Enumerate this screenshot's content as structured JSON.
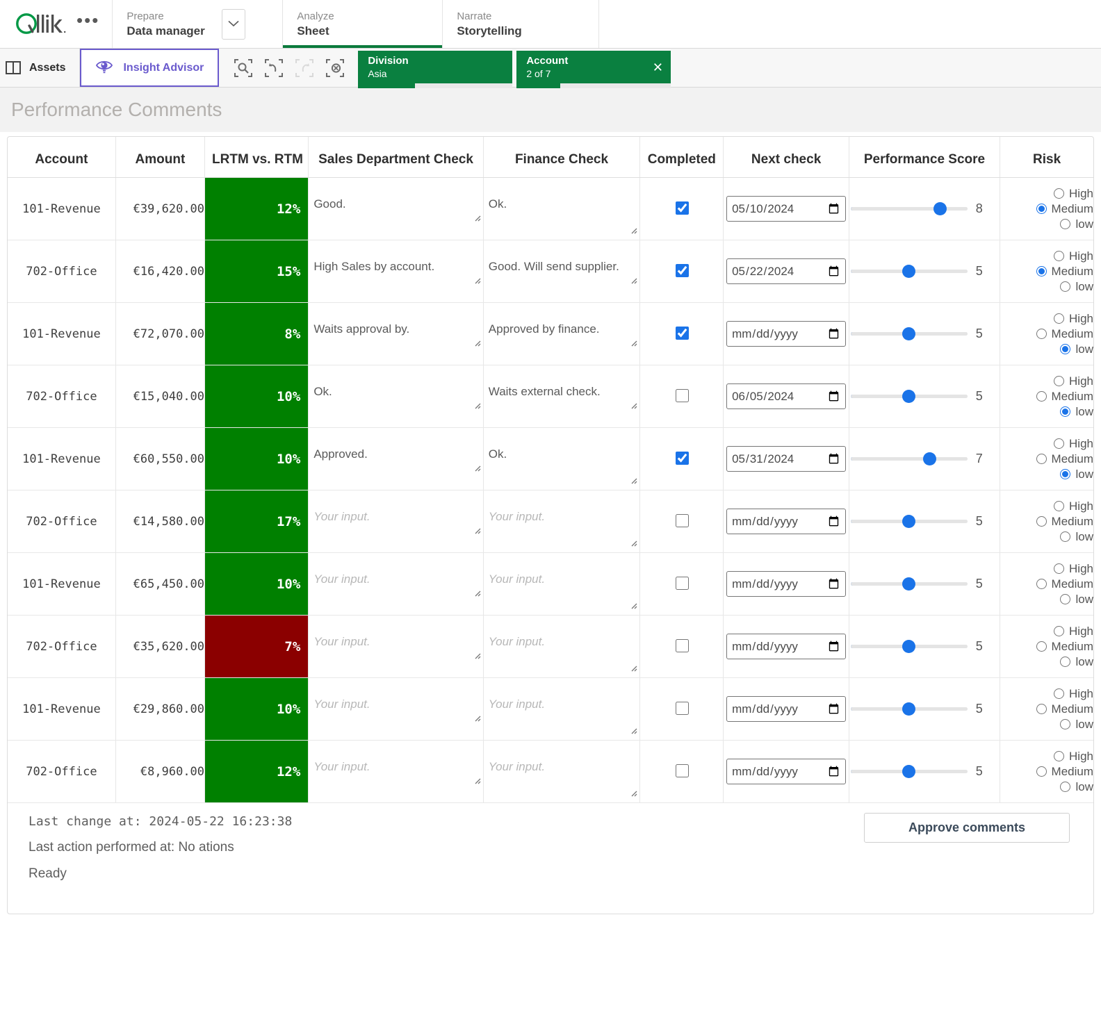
{
  "topnav": {
    "logo_text": "Qlik",
    "overflow_menu": "•••",
    "sections": [
      {
        "kicker": "Prepare",
        "title": "Data manager"
      },
      {
        "kicker": "Analyze",
        "title": "Sheet"
      },
      {
        "kicker": "Narrate",
        "title": "Storytelling"
      }
    ]
  },
  "subbar": {
    "assets_label": "Assets",
    "insight_advisor_label": "Insight Advisor",
    "tools": [
      {
        "name": "selection-search-icon",
        "disabled": false
      },
      {
        "name": "step-back-icon",
        "disabled": false
      },
      {
        "name": "step-forward-icon",
        "disabled": true
      },
      {
        "name": "clear-selections-icon",
        "disabled": false
      }
    ],
    "chips": [
      {
        "field": "Division",
        "value": "Asia",
        "fill_pct": 37,
        "closable": false
      },
      {
        "field": "Account",
        "value": "2 of 7",
        "fill_pct": 28,
        "closable": true,
        "close_glyph": "×"
      }
    ]
  },
  "sheet": {
    "title": "Performance Comments"
  },
  "table": {
    "headers": [
      "Account",
      "Amount",
      "LRTM vs. RTM",
      "Sales Department Check",
      "Finance Check",
      "Completed",
      "Next check",
      "Performance Score",
      "Risk"
    ],
    "colors": {
      "positive": "#008000",
      "negative": "#8B0000",
      "accent": "#1a73e8"
    },
    "placeholder": "Your input.",
    "date_placeholder": "dd/mm/yyyy",
    "risk_options": [
      "High",
      "Medium",
      "low"
    ],
    "rows": [
      {
        "account": "101-Revenue",
        "amount": "€39,620.00",
        "lrtm": "12%",
        "lrtm_positive": true,
        "sales": "Good.",
        "finance": "Ok.",
        "completed": true,
        "next_check": "2024-05-10",
        "next_check_display": "10/05/2024",
        "score": 8,
        "risk": "Medium"
      },
      {
        "account": "702-Office",
        "amount": "€16,420.00",
        "lrtm": "15%",
        "lrtm_positive": true,
        "sales": "High Sales by account.",
        "finance": "Good. Will send supplier.",
        "completed": true,
        "next_check": "2024-05-22",
        "next_check_display": "22/05/2024",
        "score": 5,
        "risk": "Medium"
      },
      {
        "account": "101-Revenue",
        "amount": "€72,070.00",
        "lrtm": "8%",
        "lrtm_positive": true,
        "sales": "Waits approval by.",
        "finance": "Approved by finance.",
        "completed": true,
        "next_check": "",
        "next_check_display": "dd/mm/yyyy",
        "score": 5,
        "risk": "low"
      },
      {
        "account": "702-Office",
        "amount": "€15,040.00",
        "lrtm": "10%",
        "lrtm_positive": true,
        "sales": "Ok.",
        "finance": "Waits external check.",
        "completed": false,
        "next_check": "2024-06-05",
        "next_check_display": "05/06/2024",
        "score": 5,
        "risk": "low"
      },
      {
        "account": "101-Revenue",
        "amount": "€60,550.00",
        "lrtm": "10%",
        "lrtm_positive": true,
        "sales": "Approved.",
        "finance": "Ok.",
        "completed": true,
        "next_check": "2024-05-31",
        "next_check_display": "31/05/2024",
        "score": 7,
        "risk": "low"
      },
      {
        "account": "702-Office",
        "amount": "€14,580.00",
        "lrtm": "17%",
        "lrtm_positive": true,
        "sales": "",
        "finance": "",
        "completed": false,
        "next_check": "",
        "next_check_display": "dd/mm/yyyy",
        "score": 5,
        "risk": ""
      },
      {
        "account": "101-Revenue",
        "amount": "€65,450.00",
        "lrtm": "10%",
        "lrtm_positive": true,
        "sales": "",
        "finance": "",
        "completed": false,
        "next_check": "",
        "next_check_display": "dd/mm/yyyy",
        "score": 5,
        "risk": ""
      },
      {
        "account": "702-Office",
        "amount": "€35,620.00",
        "lrtm": "7%",
        "lrtm_positive": false,
        "sales": "",
        "finance": "",
        "completed": false,
        "next_check": "",
        "next_check_display": "dd/mm/yyyy",
        "score": 5,
        "risk": ""
      },
      {
        "account": "101-Revenue",
        "amount": "€29,860.00",
        "lrtm": "10%",
        "lrtm_positive": true,
        "sales": "",
        "finance": "",
        "completed": false,
        "next_check": "",
        "next_check_display": "dd/mm/yyyy",
        "score": 5,
        "risk": ""
      },
      {
        "account": "702-Office",
        "amount": "€8,960.00",
        "lrtm": "12%",
        "lrtm_positive": true,
        "sales": "",
        "finance": "",
        "completed": false,
        "next_check": "",
        "next_check_display": "dd/mm/yyyy",
        "score": 5,
        "risk": ""
      }
    ]
  },
  "footer": {
    "last_change": "Last change at: 2024-05-22 16:23:38",
    "last_action": "Last action performed at: No ations",
    "status": "Ready",
    "approve_label": "Approve comments"
  }
}
